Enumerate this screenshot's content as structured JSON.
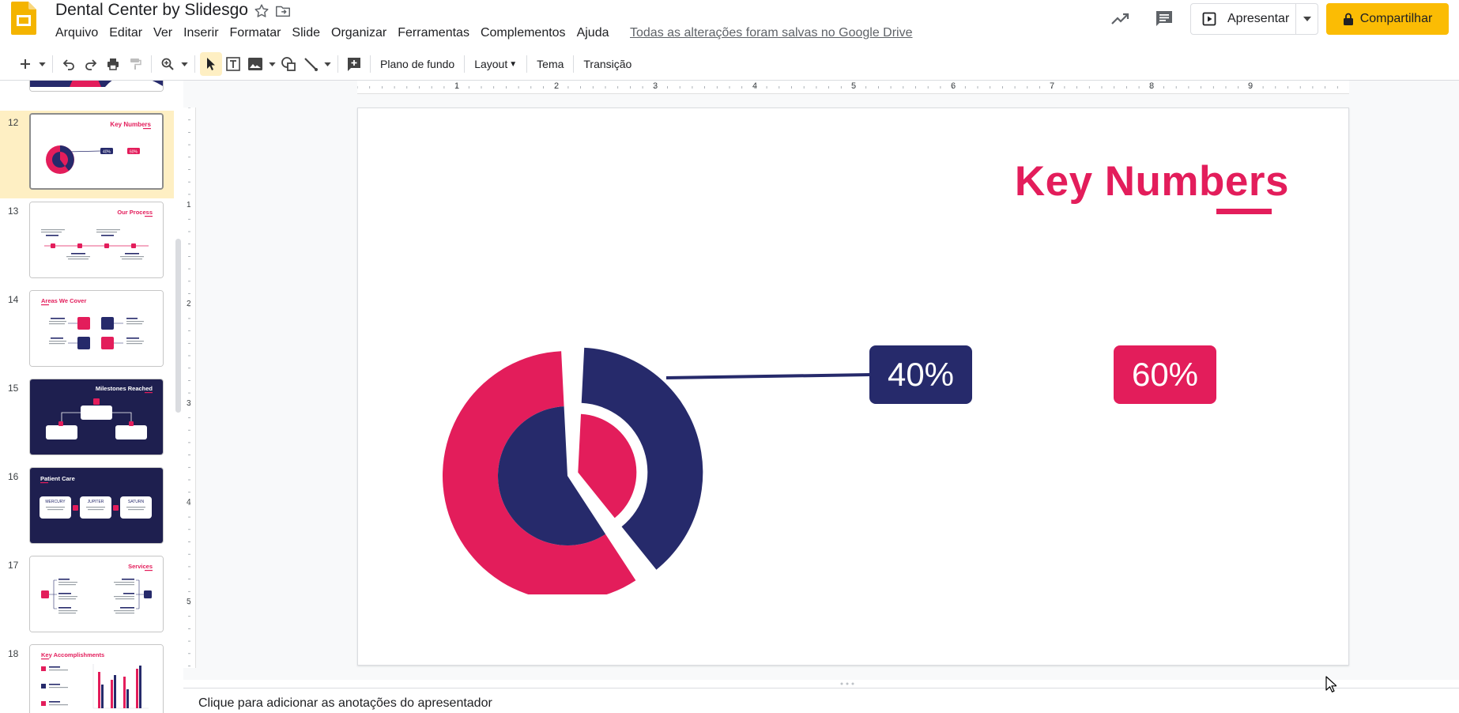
{
  "header": {
    "title": "Dental Center by Slidesgo",
    "menu": [
      "Arquivo",
      "Editar",
      "Ver",
      "Inserir",
      "Formatar",
      "Slide",
      "Organizar",
      "Ferramentas",
      "Complementos",
      "Ajuda"
    ],
    "saved_status": "Todas as alterações foram salvas no Google Drive",
    "present_label": "Apresentar",
    "share_label": "Compartilhar"
  },
  "toolbar": {
    "background_label": "Plano de fundo",
    "layout_label": "Layout",
    "theme_label": "Tema",
    "transition_label": "Transição"
  },
  "ruler": {
    "top": [
      "1",
      "2",
      "3",
      "4",
      "5",
      "6",
      "7",
      "8",
      "9"
    ],
    "left": [
      "1",
      "2",
      "3",
      "4",
      "5"
    ]
  },
  "filmstrip": {
    "slides": [
      {
        "number": "12",
        "title": "Key Numbers",
        "labels": [
          "40%",
          "60%"
        ]
      },
      {
        "number": "13",
        "title": "Our Process"
      },
      {
        "number": "14",
        "title": "Areas We Cover"
      },
      {
        "number": "15",
        "title": "Milestones Reached"
      },
      {
        "number": "16",
        "title": "Patient Care",
        "labels": [
          "MERCURY",
          "JUPITER",
          "SATURN"
        ]
      },
      {
        "number": "17",
        "title": "Services"
      },
      {
        "number": "18",
        "title": "Key Accomplishments"
      }
    ]
  },
  "slide": {
    "title": "Key Numbers",
    "stat_left": "40%",
    "stat_right": "60%"
  },
  "chart_data": {
    "type": "pie",
    "categories": [
      "40%",
      "60%"
    ],
    "values": [
      40,
      60
    ],
    "colors": [
      "#262a6b",
      "#e31d5b"
    ]
  },
  "notes": {
    "placeholder": "Clique para adicionar as anotações do apresentador"
  },
  "colors": {
    "accent_pink": "#e31d5b",
    "accent_navy": "#262a6b",
    "share_yellow": "#fbbc04",
    "selected_highlight": "#feefc3"
  }
}
